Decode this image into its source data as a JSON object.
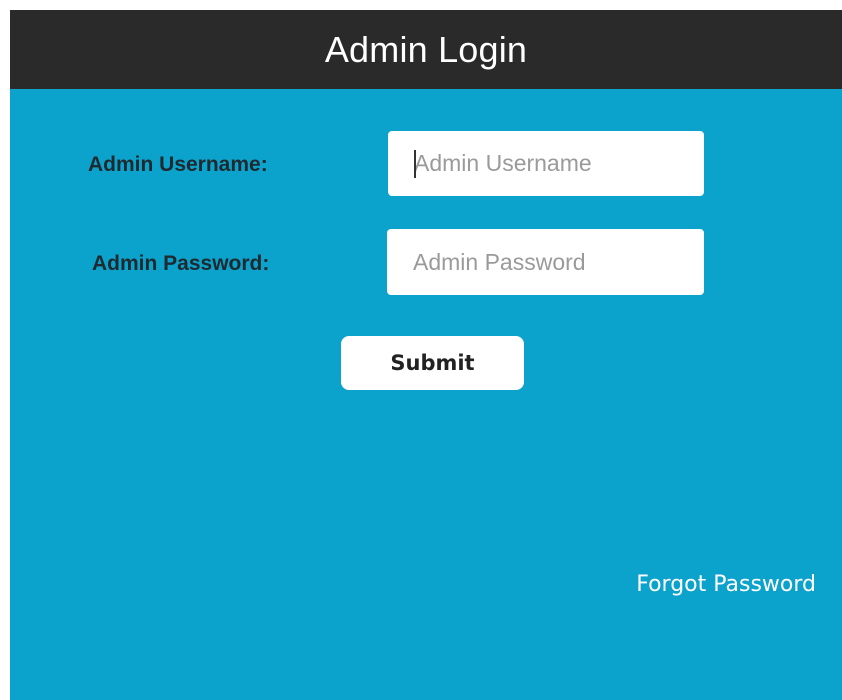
{
  "header": {
    "title": "Admin Login"
  },
  "form": {
    "username": {
      "label": "Admin Username:",
      "value": "",
      "placeholder": "Admin Username"
    },
    "password": {
      "label": "Admin Password:",
      "value": "",
      "placeholder": "Admin Password"
    },
    "submit_label": "Submit",
    "forgot_label": "Forgot Password"
  },
  "colors": {
    "panel_background": "#0ba2cc",
    "header_background": "#2b2a2a",
    "label_text": "#1f2a30",
    "input_background": "#ffffff",
    "placeholder_text": "#9a9a9a"
  }
}
